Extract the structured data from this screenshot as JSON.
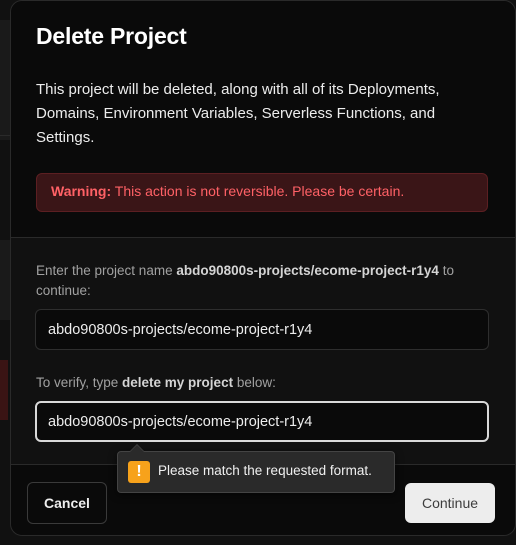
{
  "modal": {
    "title": "Delete Project",
    "description": "This project will be deleted, along with all of its Deployments, Domains, Environment Variables, Serverless Functions, and Settings.",
    "warning": {
      "prefix": "Warning:",
      "text": " This action is not reversible. Please be certain."
    },
    "project_name_prompt": {
      "before": "Enter the project name ",
      "name": "abdo90800s-projects/ecome-project-r1y4",
      "after": " to continue:"
    },
    "project_name_value": "abdo90800s-projects/ecome-project-r1y4",
    "verify_prompt": {
      "before": "To verify, type ",
      "phrase": "delete my project",
      "after": " below:"
    },
    "verify_value": "abdo90800s-projects/ecome-project-r1y4",
    "validation_message": "Please match the requested format.",
    "cancel_label": "Cancel",
    "continue_label": "Continue"
  },
  "icons": {
    "validation": "warning-icon"
  },
  "colors": {
    "warning_text": "#ff6166",
    "warning_bg": "#3a1517",
    "tooltip_icon": "#f7a21b"
  }
}
